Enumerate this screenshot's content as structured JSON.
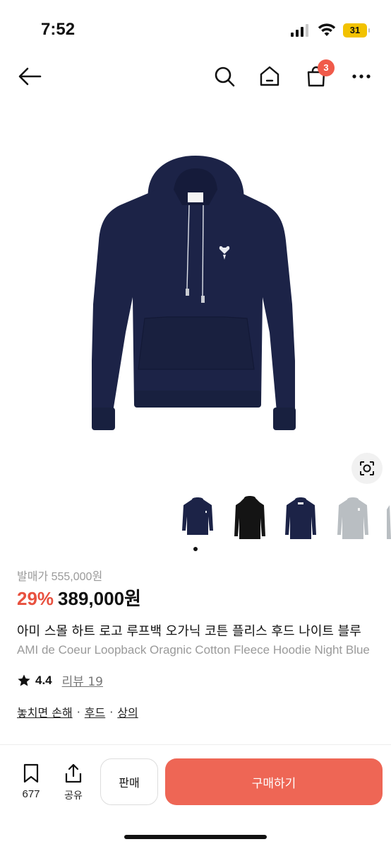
{
  "status_bar": {
    "time": "7:52",
    "battery": "31"
  },
  "nav": {
    "cart_count": "3"
  },
  "colors": {
    "accent": "#ee6655",
    "discount": "#e8513f",
    "badge": "#f05a4a",
    "hoodie_navy": "#1c2347"
  },
  "gallery": {
    "thumbnails": [
      {
        "color": "#1c2347",
        "name": "navy"
      },
      {
        "color": "#141414",
        "name": "black"
      },
      {
        "color": "#1c2347",
        "name": "navy"
      },
      {
        "color": "#b9bec2",
        "name": "gray"
      }
    ]
  },
  "product": {
    "original_price": "발매가 555,000원",
    "discount": "29%",
    "price": "389,000원",
    "title_ko": "아미 스몰 하트 로고 루프백 오가닉 코튼 플리스 후드 나이트 블루",
    "title_en": "AMI de Coeur Loopback Oragnic Cotton Fleece Hoodie Night Blue",
    "rating": "4.4",
    "review_label": "리뷰 19",
    "tags": [
      "놓치면 손해",
      "후드",
      "상의"
    ],
    "tag_separator": "·"
  },
  "bottom_bar": {
    "bookmark_count": "677",
    "share_label": "공유",
    "sell_label": "판매",
    "buy_label": "구매하기"
  }
}
